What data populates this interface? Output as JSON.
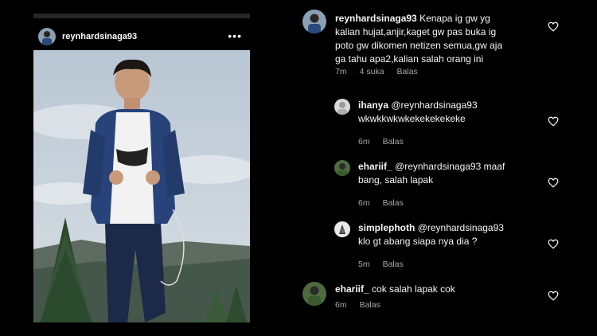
{
  "post": {
    "username": "reynhardsinaga93",
    "more_icon": "more-horizontal-icon"
  },
  "comments": [
    {
      "username": "reynhardsinaga93",
      "lines": [
        "Kenapa ig gw yg",
        "kalian hujat,anjir,kaget gw pas buka ig",
        "poto gw dikomen netizen semua,gw aja",
        "ga tahu apa2,kalian salah orang ini"
      ],
      "time": "7m",
      "likes": "4 suka",
      "reply": "Balas"
    },
    {
      "username": "ihanya",
      "lines": [
        "@reynhardsinaga93",
        "wkwkkwkwkekekekekeke"
      ],
      "time": "6m",
      "reply": "Balas"
    },
    {
      "username": "ehariif_",
      "lines": [
        "@reynhardsinaga93 maaf",
        "bang, salah lapak"
      ],
      "time": "6m",
      "reply": "Balas"
    },
    {
      "username": "simplephoth",
      "lines": [
        "@reynhardsinaga93",
        "klo gt abang siapa nya dia ?"
      ],
      "time": "5m",
      "reply": "Balas"
    },
    {
      "username": "ehariif_",
      "lines": [
        "cok salah lapak cok"
      ],
      "time": "6m",
      "reply": "Balas"
    }
  ],
  "colors": {
    "background": "#000000",
    "meta_text": "#a8a8a8",
    "top_bar": "#262626"
  }
}
